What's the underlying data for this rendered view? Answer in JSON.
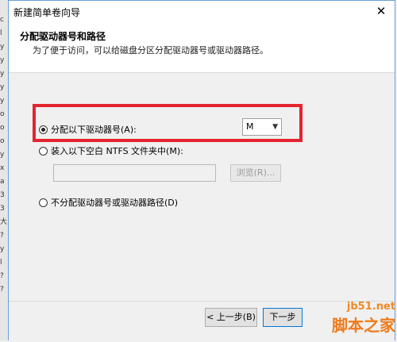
{
  "window": {
    "title": "新建简单卷向导",
    "close_glyph": "✕"
  },
  "header": {
    "title": "分配驱动器号和路径",
    "subtitle": "为了便于访问，可以给磁盘分区分配驱动器号或驱动器路径。"
  },
  "options": {
    "assign_letter_label": "分配以下驱动器号(A):",
    "assign_letter_checked": true,
    "drive_letter_value": "M",
    "mount_folder_label": "装入以下空白 NTFS 文件夹中(M):",
    "mount_folder_checked": false,
    "folder_path_value": "",
    "browse_label": "浏览(R)...",
    "no_assign_label": "不分配驱动器号或驱动器路径(D)",
    "no_assign_checked": false
  },
  "footer": {
    "back_label": "< 上一步(B)",
    "next_label": "下一步"
  },
  "watermark": {
    "line1": "jb51.net",
    "line2": "脚本之家"
  },
  "background": {
    "glyphs": [
      "c",
      "l",
      "y",
      "y",
      "y",
      "y",
      "y",
      "o",
      "o",
      "o",
      "y",
      "x",
      "a",
      "3",
      "3",
      "大",
      "?",
      "y",
      "l",
      "?",
      "?"
    ]
  },
  "colors": {
    "highlight": "#e3242f",
    "accent": "#0078d7",
    "watermark": "#f07a18"
  }
}
